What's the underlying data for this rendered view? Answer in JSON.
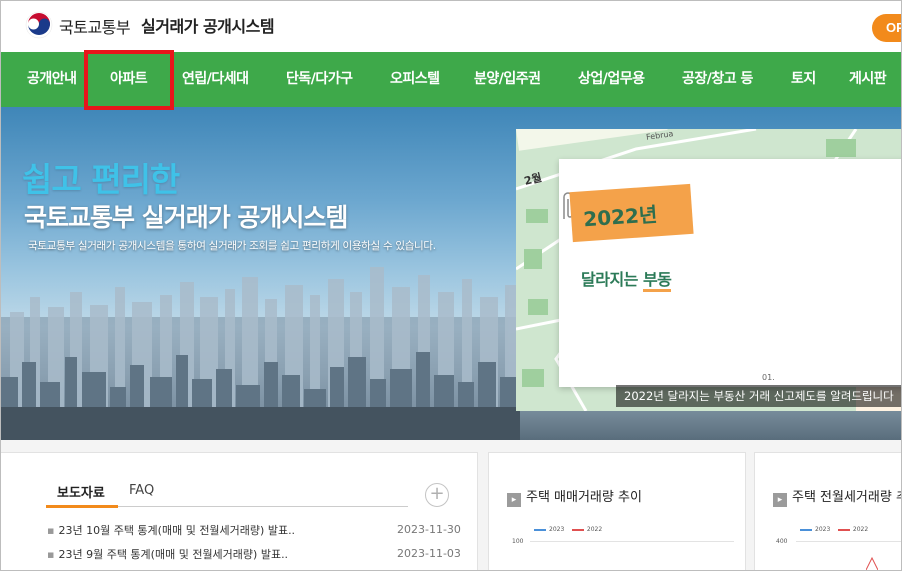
{
  "header": {
    "org_name": "국토교통부",
    "system_name": "실거래가 공개시스템",
    "right_button": "OP"
  },
  "nav": {
    "items": [
      {
        "label": "공개안내"
      },
      {
        "label": "아파트"
      },
      {
        "label": "연립/다세대"
      },
      {
        "label": "단독/다가구"
      },
      {
        "label": "오피스텔"
      },
      {
        "label": "분양/입주권"
      },
      {
        "label": "상업/업무용"
      },
      {
        "label": "공장/창고 등"
      },
      {
        "label": "토지"
      },
      {
        "label": "게시판"
      }
    ],
    "highlighted_item": "아파트"
  },
  "hero": {
    "title_line1": "쉽고 편리한",
    "title_line2": "국토교통부 실거래가 공개시스템",
    "subtitle": "국토교통부 실거래가 공개시스템을 통하여 실거래가 조회를 쉽고 편리하게 이용하실 수 있습니다."
  },
  "banner": {
    "month": "2월",
    "feb_label": "Februa",
    "year": "2022년",
    "text_prefix": "달라지는 ",
    "text_highlight": "부동",
    "small_number": "01.",
    "caption": "2022년 달라지는 부동산 거래 신고제도를 알려드립니다"
  },
  "news_panel": {
    "tabs": [
      "보도자료",
      "FAQ"
    ],
    "active_tab": "보도자료",
    "plus": "+",
    "items": [
      {
        "title": "23년 10월 주택 통계(매매 및 전월세거래량) 발표..",
        "date": "2023-11-30"
      },
      {
        "title": "23년 9월 주택 통계(매매 및 전월세거래량) 발표..",
        "date": "2023-11-03"
      }
    ]
  },
  "charts": [
    {
      "title": "주택 매매거래량 추이",
      "legend": [
        "2023",
        "2022"
      ],
      "y_tick": "100"
    },
    {
      "title": "주택 전월세거래량 추이",
      "legend": [
        "2023",
        "2022"
      ],
      "y_tick": "400"
    }
  ],
  "colors": {
    "nav_green": "#3ea94a",
    "accent_orange": "#f28a1b",
    "highlight_red": "#e8161b",
    "series_2023": "#4a90d9",
    "series_2022": "#e05050"
  }
}
